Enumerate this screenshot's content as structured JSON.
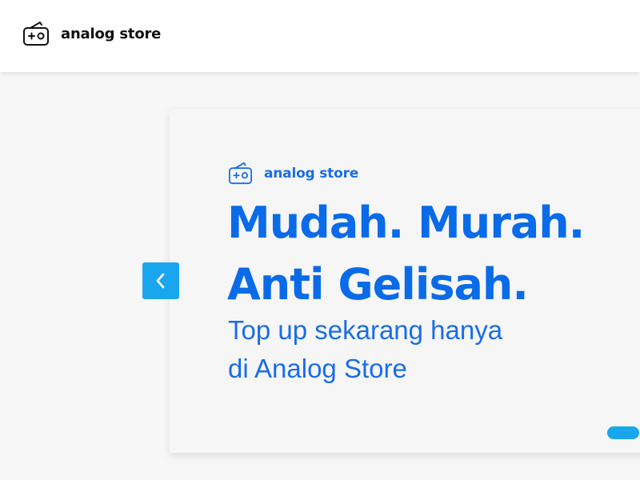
{
  "navbar": {
    "brand_name": "analog store",
    "logo_icon": "gamepad-radio-icon"
  },
  "carousel": {
    "prev_icon": "chevron-left-icon",
    "slides": [
      {
        "brand_name": "analog store",
        "logo_icon": "gamepad-radio-icon",
        "headline_line1": "Mudah. Murah.",
        "headline_line2": "Anti Gelisah.",
        "subline_line1": "Top up sekarang hanya",
        "subline_line2": "di Analog Store"
      }
    ],
    "active_index": 0
  },
  "colors": {
    "brand_blue": "#0a6be8",
    "accent_cyan": "#1aa6ee",
    "navbar_bg": "#ffffff",
    "page_bg": "#f7f7f7",
    "brand_text_dark": "#111111"
  }
}
